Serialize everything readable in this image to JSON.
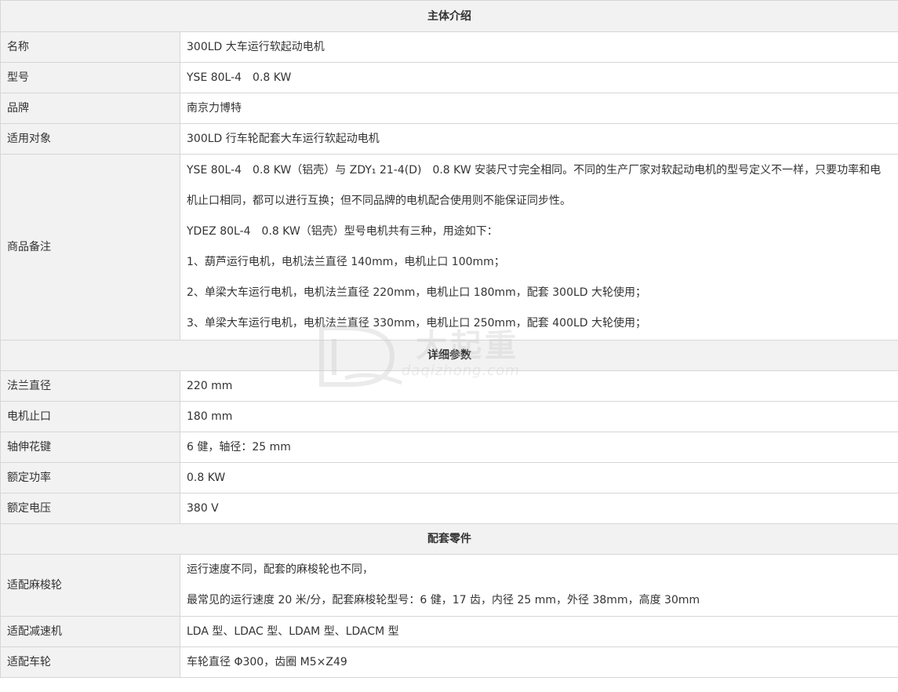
{
  "sections": {
    "intro": "主体介绍",
    "params": "详细参数",
    "parts": "配套零件"
  },
  "intro": {
    "name_label": "名称",
    "name_value": "300LD 大车运行软起动电机",
    "model_label": "型号",
    "model_value": "YSE 80L-4　0.8 KW",
    "brand_label": "品牌",
    "brand_value": "南京力博特",
    "target_label": "适用对象",
    "target_value": "300LD 行车轮配套大车运行软起动电机",
    "notes_label": "商品备注",
    "notes": [
      "YSE 80L-4　0.8 KW（铝壳）与 ZDY₁ 21-4(D)　0.8 KW 安装尺寸完全相同。不同的生产厂家对软起动电机的型号定义不一样，只要功率和电机止口相同，都可以进行互换；但不同品牌的电机配合使用则不能保证同步性。",
      "YDEZ 80L-4　0.8 KW（铝壳）型号电机共有三种，用途如下：",
      "1、葫芦运行电机，电机法兰直径 140mm，电机止口 100mm；",
      "2、单梁大车运行电机，电机法兰直径 220mm，电机止口 180mm，配套 300LD 大轮使用；",
      "3、单梁大车运行电机，电机法兰直径 330mm，电机止口 250mm，配套 400LD 大轮使用；"
    ]
  },
  "params": {
    "flange_label": "法兰直径",
    "flange_value": "220 mm",
    "spigot_label": "电机止口",
    "spigot_value": "180 mm",
    "spline_label": "轴伸花键",
    "spline_value": "6 健，轴径：25 mm",
    "power_label": "额定功率",
    "power_value": "0.8 KW",
    "voltage_label": "额定电压",
    "voltage_value": "380 V"
  },
  "parts": {
    "spline_wheel_label": "适配麻梭轮",
    "spline_wheel_lines": [
      "运行速度不同，配套的麻梭轮也不同，",
      "最常见的运行速度 20 米/分，配套麻梭轮型号：6 健，17 齿，内径 25 mm，外径 38mm，高度 30mm"
    ],
    "reducer_label": "适配减速机",
    "reducer_value": "LDA 型、LDAC 型、LDAM 型、LDACM 型",
    "wheel_label": "适配车轮",
    "wheel_value": "车轮直径 Φ300，齿圈 M5×Z49"
  },
  "watermark": {
    "cn": "大起重",
    "en": "daqizhong.com"
  }
}
